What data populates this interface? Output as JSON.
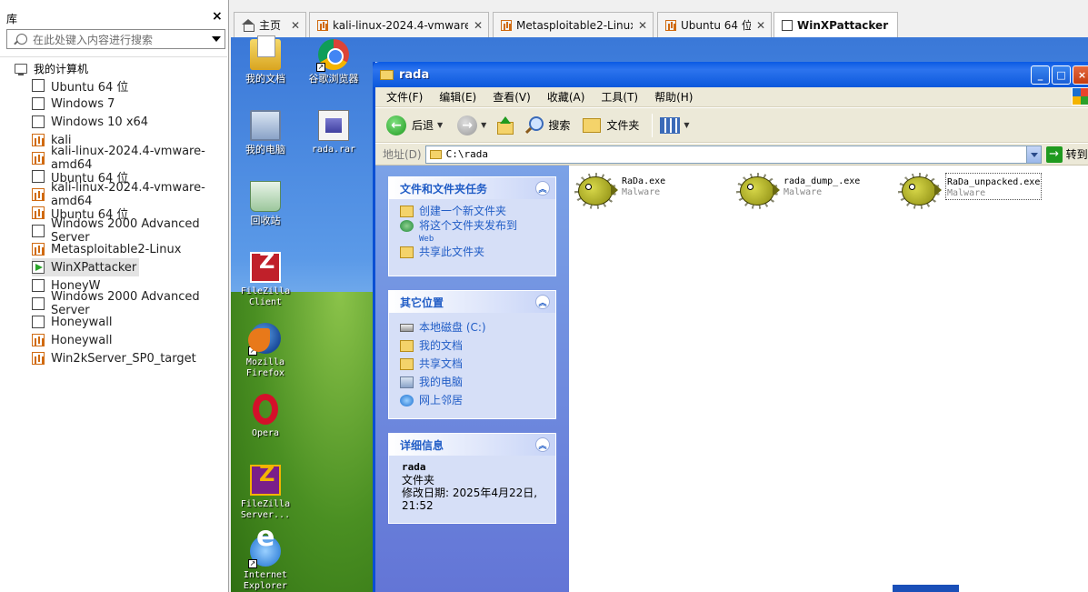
{
  "library": {
    "title": "库",
    "close": "×",
    "search_placeholder": "在此处键入内容进行搜索",
    "root": "我的计算机",
    "vms": [
      {
        "name": "Ubuntu 64 位",
        "type": "normal"
      },
      {
        "name": "Windows 7",
        "type": "normal"
      },
      {
        "name": "Windows 10 x64",
        "type": "normal"
      },
      {
        "name": "kali",
        "type": "kali"
      },
      {
        "name": "kali-linux-2024.4-vmware-amd64",
        "type": "kali"
      },
      {
        "name": "Ubuntu 64 位",
        "type": "normal"
      },
      {
        "name": "kali-linux-2024.4-vmware-amd64",
        "type": "kali"
      },
      {
        "name": "Ubuntu 64 位",
        "type": "kali"
      },
      {
        "name": "Windows 2000 Advanced Server",
        "type": "normal"
      },
      {
        "name": "Metasploitable2-Linux",
        "type": "kali"
      },
      {
        "name": "WinXPattacker",
        "type": "running"
      },
      {
        "name": "HoneyW",
        "type": "normal"
      },
      {
        "name": "Windows 2000 Advanced Server",
        "type": "normal"
      },
      {
        "name": "Honeywall",
        "type": "normal"
      },
      {
        "name": "Honeywall",
        "type": "kali"
      },
      {
        "name": "Win2kServer_SP0_target",
        "type": "kali"
      }
    ]
  },
  "tabs": [
    {
      "label": "主页",
      "icon": "home-icon"
    },
    {
      "label": "kali-linux-2024.4-vmware-am...",
      "icon": "vm-icon"
    },
    {
      "label": "Metasploitable2-Linux",
      "icon": "vm-icon"
    },
    {
      "label": "Ubuntu 64 位",
      "icon": "vm-icon"
    },
    {
      "label": "WinXPattacker",
      "icon": "vm-icon"
    }
  ],
  "desktop": {
    "icons": [
      {
        "label": "我的文档",
        "icon": "my-documents-icon"
      },
      {
        "label": "谷歌浏览器",
        "icon": "chrome-icon"
      },
      {
        "label": "我的电脑",
        "icon": "my-computer-icon"
      },
      {
        "label": "rada.rar",
        "icon": "rar-icon"
      },
      {
        "label": "回收站",
        "icon": "recycle-bin-icon"
      },
      {
        "label": "FileZilla Client",
        "icon": "filezilla-icon"
      },
      {
        "label": "Mozilla Firefox",
        "icon": "firefox-icon"
      },
      {
        "label": "Opera",
        "icon": "opera-icon"
      },
      {
        "label": "FileZilla Server...",
        "icon": "filezilla-server-icon"
      },
      {
        "label": "Internet Explorer",
        "icon": "ie-icon"
      }
    ]
  },
  "explorer": {
    "title": "rada",
    "buttons": {
      "minimize": "_",
      "maximize": "□",
      "close": "×"
    },
    "menu": [
      "文件(F)",
      "编辑(E)",
      "查看(V)",
      "收藏(A)",
      "工具(T)",
      "帮助(H)"
    ],
    "toolbar": {
      "back": "后退",
      "search": "搜索",
      "folders": "文件夹"
    },
    "address": {
      "label": "地址(D)",
      "value": "C:\\rada",
      "go": "转到"
    },
    "panels": {
      "tasks": {
        "title": "文件和文件夹任务",
        "items": [
          "创建一个新文件夹",
          "将这个文件夹发布到",
          "Web",
          "共享此文件夹"
        ]
      },
      "places": {
        "title": "其它位置",
        "items": [
          "本地磁盘 (C:)",
          "我的文档",
          "共享文档",
          "我的电脑",
          "网上邻居"
        ]
      },
      "details": {
        "title": "详细信息",
        "name": "rada",
        "kind": "文件夹",
        "modified": "修改日期: 2025年4月22日,",
        "time": "21:52"
      }
    },
    "files": [
      {
        "name": "RaDa.exe",
        "type": "Malware"
      },
      {
        "name": "rada_dump_.exe",
        "type": "Malware"
      },
      {
        "name": "RaDa_unpacked.exe",
        "type": "Malware"
      }
    ]
  }
}
